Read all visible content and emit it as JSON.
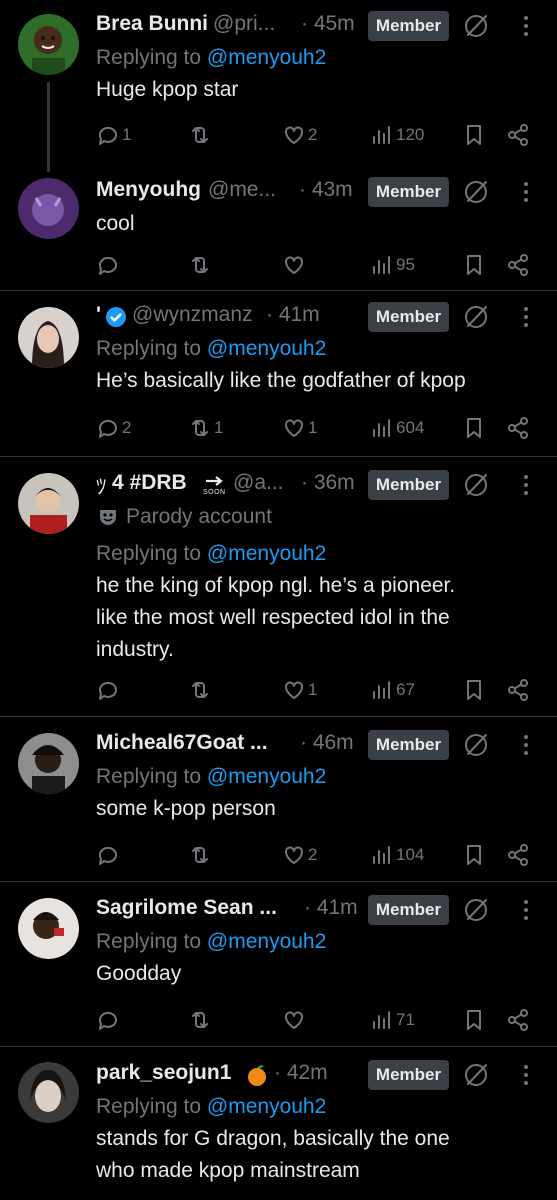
{
  "badge_label": "Member",
  "posts": [
    {
      "name": "Brea Bunni",
      "handle": "@pri...",
      "time": "· 45m",
      "replying_prefix": "Replying to ",
      "replying_to": "@menyouh2",
      "text": "Huge kpop star",
      "stats": {
        "replies": "1",
        "reposts": "",
        "likes": "2",
        "views": "120"
      }
    },
    {
      "name": "Menyouhg",
      "handle": "@me...",
      "time": "· 43m",
      "text": "cool",
      "stats": {
        "replies": "",
        "reposts": "",
        "likes": "",
        "views": "95"
      }
    },
    {
      "name": "'",
      "handle": "@wynzmanz",
      "time": "· 41m",
      "replying_prefix": "Replying to ",
      "replying_to": "@menyouh2",
      "text": "He’s basically like the godfather of kpop",
      "stats": {
        "replies": "2",
        "reposts": "1",
        "likes": "1",
        "views": "604"
      }
    },
    {
      "name": "4 #DRB",
      "soon_label": "SOON",
      "handle": "@a...",
      "time": "· 36m",
      "parody_label": "Parody account",
      "replying_prefix": "Replying to ",
      "replying_to": "@menyouh2",
      "text_lines": [
        "he the king of kpop ngl. he’s a pioneer.",
        "like the most well respected idol in the",
        "industry."
      ],
      "stats": {
        "replies": "",
        "reposts": "",
        "likes": "1",
        "views": "67"
      }
    },
    {
      "name": "Micheal67Goat ...",
      "time": "· 46m",
      "replying_prefix": "Replying to ",
      "replying_to": "@menyouh2",
      "text": "some k-pop person",
      "stats": {
        "replies": "",
        "reposts": "",
        "likes": "2",
        "views": "104"
      }
    },
    {
      "name": "Sagrilome Sean ...",
      "time": "· 41m",
      "replying_prefix": "Replying to ",
      "replying_to": "@menyouh2",
      "text": "Goodday",
      "stats": {
        "replies": "",
        "reposts": "",
        "likes": "",
        "views": "71"
      }
    },
    {
      "name": "park_seojun1",
      "time": "· 42m",
      "replying_prefix": "Replying to ",
      "replying_to": "@menyouh2",
      "text_lines": [
        "stands for G dragon, basically the one",
        "who made kpop mainstream"
      ]
    }
  ],
  "colors": {
    "background": "#000000",
    "text": "#e7e9ea",
    "muted": "#71767b",
    "link": "#1d9bf0",
    "badge": "#3a4046",
    "divider": "#2f3336",
    "verified": "#1d9bf0"
  },
  "icons": [
    "reply-icon",
    "repost-icon",
    "like-icon",
    "views-icon",
    "bookmark-icon",
    "share-icon",
    "no-entry-icon",
    "more-icon",
    "verified-icon",
    "parody-mask-icon",
    "orange-emoji-icon",
    "soon-arrow-icon"
  ]
}
